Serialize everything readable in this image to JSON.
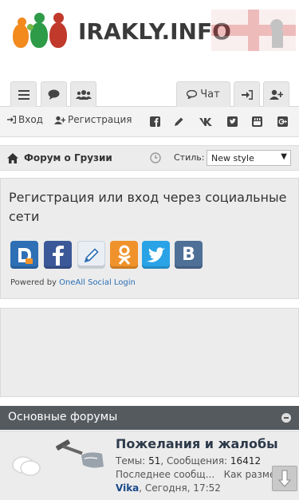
{
  "header": {
    "logo_text": "IRAKLY.INFO",
    "logo_colors": [
      "#f28a1e",
      "#7ab648",
      "#2d9b47",
      "#c0392b"
    ]
  },
  "tabs": {
    "chat_label": "Чат"
  },
  "toolbar": {
    "login_label": "Вход",
    "register_label": "Регистрация",
    "social_icons": [
      "facebook-icon",
      "pencil-icon",
      "vk-icon",
      "twitter-icon",
      "youtube-icon",
      "google-plus-icon"
    ]
  },
  "breadcrumb": {
    "title": "Форум о Грузии",
    "style_label": "Стиль:",
    "style_value": "New style"
  },
  "login_panel": {
    "title": "Регистрация или вход через социальные сети",
    "providers": [
      {
        "name": "disqus",
        "color": "#2e6fb5"
      },
      {
        "name": "facebook",
        "color": "#3b5998"
      },
      {
        "name": "livejournal",
        "color": "#e8eef3"
      },
      {
        "name": "odnoklassniki",
        "color": "#f0922b"
      },
      {
        "name": "twitter",
        "color": "#29a3e6"
      },
      {
        "name": "vkontakte",
        "color": "#4e6f96"
      }
    ],
    "powered_prefix": "Powered by",
    "powered_link": "OneAll Social Login"
  },
  "forums": {
    "section_title": "Основные форумы",
    "rows": [
      {
        "name": "Пожелания и жалобы",
        "topics_label": "Темы:",
        "topics": "51",
        "posts_label": ", Сообщения:",
        "posts": "16412",
        "last_label": "Последнее сообщ...",
        "last_title": "Как разме...",
        "author": "Vika",
        "time": ", Сегодня, 17:52"
      }
    ]
  }
}
